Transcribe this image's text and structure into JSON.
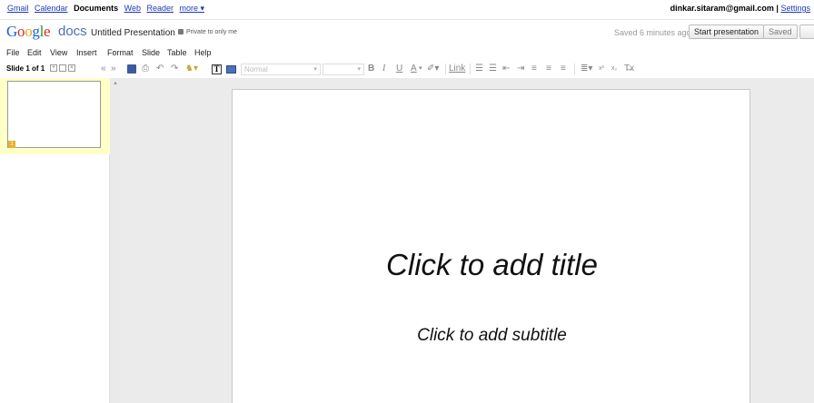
{
  "topnav": {
    "items": [
      "Gmail",
      "Calendar",
      "Documents",
      "Web",
      "Reader",
      "more ▾"
    ],
    "current": "Documents"
  },
  "account": {
    "email": "dinkar.sitaram@gmail.com",
    "separator": "|",
    "settings": "Settings"
  },
  "header": {
    "logo": {
      "G": "G",
      "o1": "o",
      "o2": "o",
      "g": "g",
      "l": "l",
      "e": "e"
    },
    "docs_word": "docs",
    "title": "Untitled Presentation",
    "privacy": "Private to only me",
    "saved_status": "Saved 6 minutes ago",
    "start_presentation": "Start presentation",
    "saved_button": "Saved"
  },
  "menu": [
    "File",
    "Edit",
    "View",
    "Insert",
    "Format",
    "Slide",
    "Table",
    "Help"
  ],
  "toolbar": {
    "slide_counter": "Slide 1 of 1",
    "font_style": "Normal",
    "font_size": "",
    "link": "Link",
    "bold": "B",
    "italic": "I",
    "underline": "U",
    "text_color": "A",
    "clear_format": "T̶x"
  },
  "filmstrip": {
    "selected_slide_number": "1"
  },
  "slide": {
    "title_placeholder": "Click to add title",
    "subtitle_placeholder": "Click to add subtitle"
  },
  "colors": {
    "link": "#1c39bb",
    "selection": "#ffffc8",
    "canvas": "#ebebeb"
  }
}
